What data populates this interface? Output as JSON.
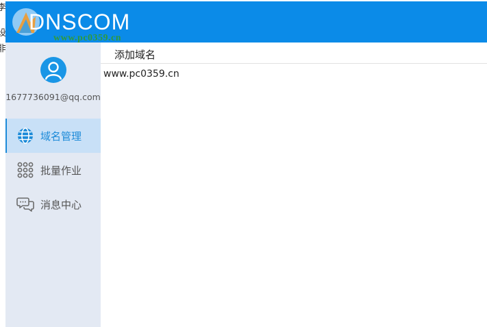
{
  "edge_chars": [
    "李",
    "设",
    "非"
  ],
  "header": {
    "logo_text": "DNSCOM",
    "watermark": "www.pc0359.cn",
    "bg_color": "#0b8be8"
  },
  "sidebar": {
    "user_email": "1677736091@qq.com",
    "items": [
      {
        "label": "域名管理",
        "icon": "globe-icon",
        "active": true
      },
      {
        "label": "批量作业",
        "icon": "grid-dots-icon",
        "active": false
      },
      {
        "label": "消息中心",
        "icon": "chat-bubbles-icon",
        "active": false
      }
    ]
  },
  "main": {
    "tab_label": "添加域名",
    "domains": [
      "www.pc0359.cn"
    ]
  },
  "colors": {
    "accent": "#1c8ad8",
    "sidebar_bg": "#e3e9f3",
    "active_bg": "#c8e0f7"
  }
}
